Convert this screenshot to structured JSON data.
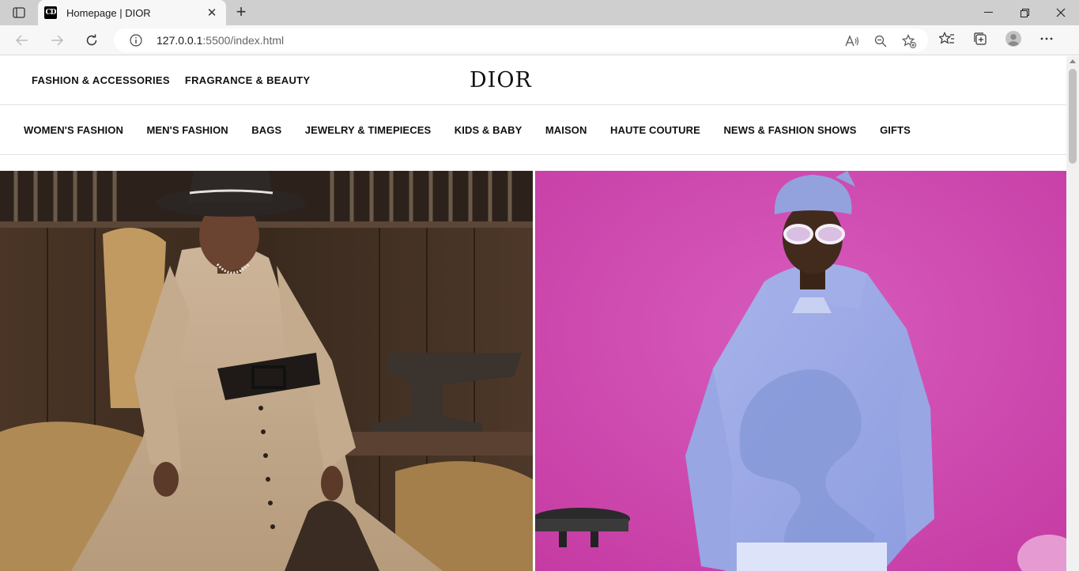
{
  "browser": {
    "tab_title": "Homepage | DIOR",
    "favicon_text": "CD",
    "url_host": "127.0.0.1",
    "url_rest": ":5500/index.html"
  },
  "header": {
    "logo": "DIOR",
    "top_links": [
      "FASHION & ACCESSORIES",
      "FRAGRANCE & BEAUTY"
    ]
  },
  "nav": {
    "items": [
      "WOMEN'S FASHION",
      "MEN'S FASHION",
      "BAGS",
      "JEWELRY & TIMEPIECES",
      "KIDS & BABY",
      "MAISON",
      "HAUTE COUTURE",
      "NEWS & FASHION SHOWS",
      "GIFTS"
    ]
  },
  "hero": {
    "left_image": "woman-in-stable-photo",
    "right_image": "man-in-blue-hoodie-photo"
  }
}
